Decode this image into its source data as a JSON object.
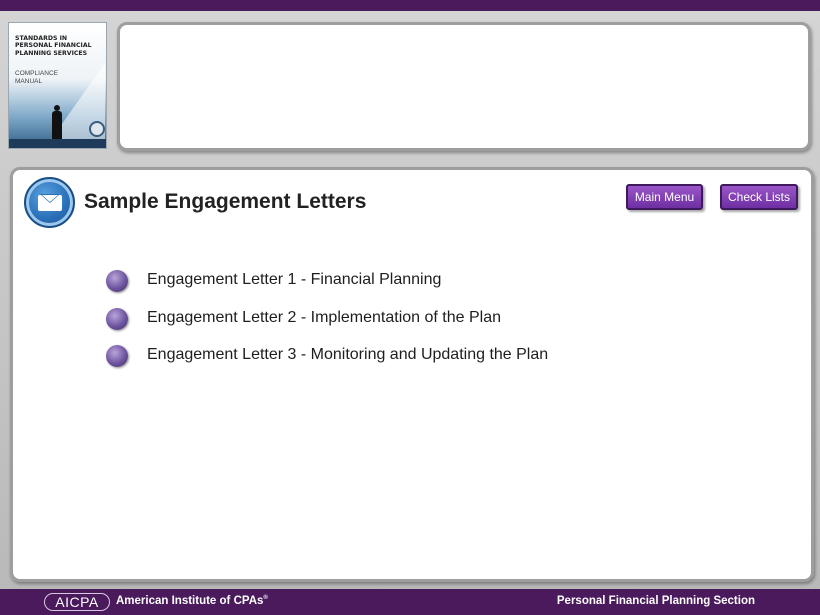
{
  "cover": {
    "title": "STANDARDS IN\nPERSONAL FINANCIAL\nPLANNING SERVICES",
    "subtitle": "COMPLIANCE\nMANUAL"
  },
  "section": {
    "title": "Sample Engagement  Letters",
    "icon": "envelope-icon"
  },
  "nav": {
    "main_menu_label": "Main Menu",
    "check_lists_label": "Check Lists"
  },
  "letters": [
    {
      "label": "Engagement Letter 1 - Financial Planning"
    },
    {
      "label": "Engagement Letter 2 - Implementation of the Plan"
    },
    {
      "label": "Engagement Letter 3 - Monitoring and Updating the Plan"
    }
  ],
  "footer": {
    "logo_text": "AICPA",
    "org_name": "American Institute of CPAs",
    "org_mark": "®",
    "section_name": "Personal Financial Planning Section"
  },
  "colors": {
    "brand_purple": "#4a1a5c",
    "button_purple": "#7e3fb2",
    "icon_blue": "#2a70b8"
  }
}
